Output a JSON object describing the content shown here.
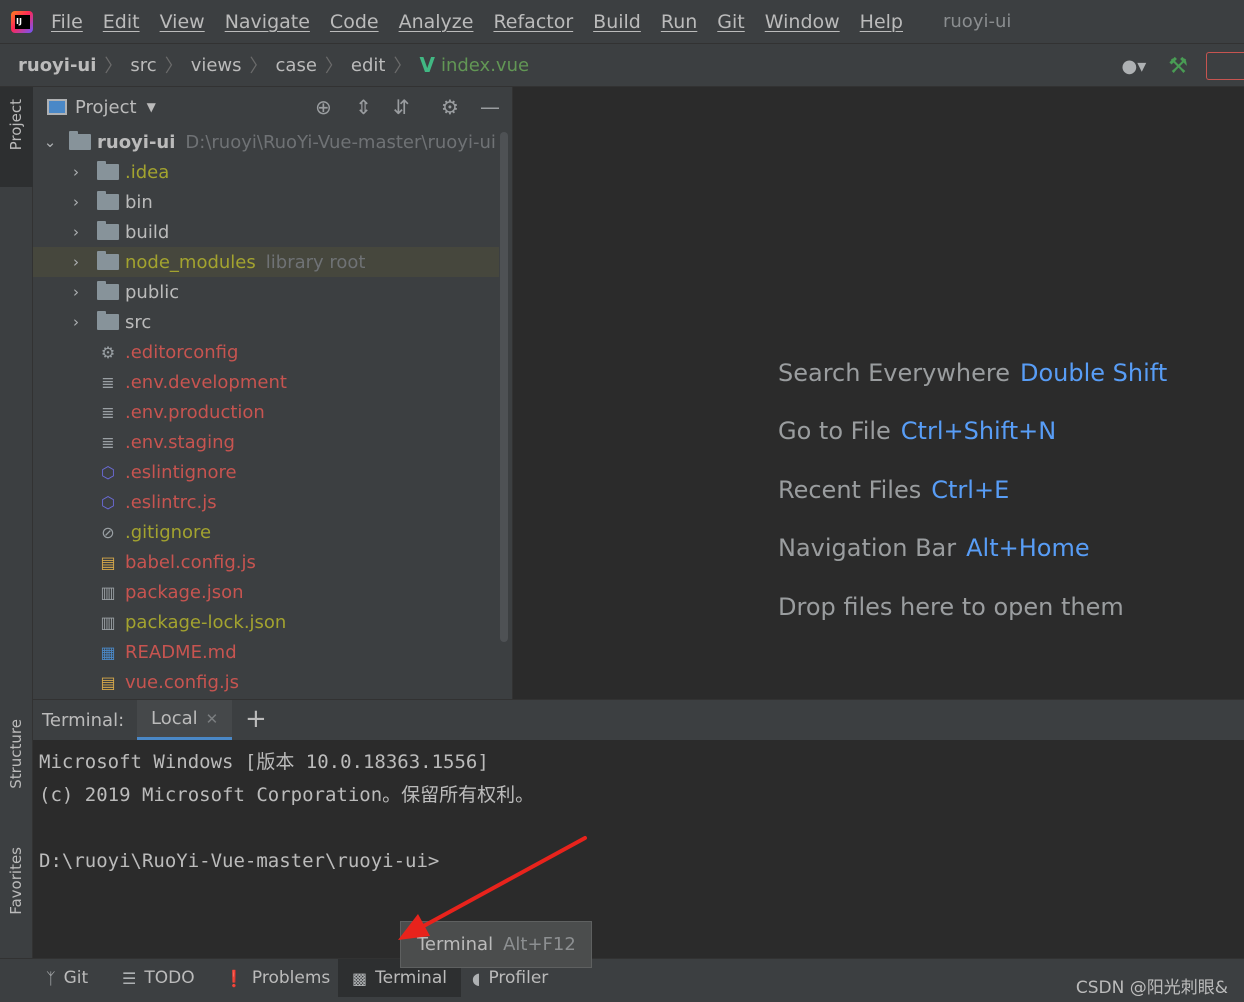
{
  "menubar": {
    "items": [
      "File",
      "Edit",
      "View",
      "Navigate",
      "Code",
      "Analyze",
      "Refactor",
      "Build",
      "Run",
      "Git",
      "Window",
      "Help"
    ],
    "window_title": "ruoyi-ui"
  },
  "navbar": {
    "crumbs": [
      "ruoyi-ui",
      "src",
      "views",
      "case",
      "edit"
    ],
    "file": "index.vue"
  },
  "left_strip": {
    "project": "Project",
    "structure": "Structure",
    "favorites": "Favorites"
  },
  "project": {
    "title": "Project",
    "root_name": "ruoyi-ui",
    "root_path": "D:\\ruoyi\\RuoYi-Vue-master\\ruoyi-ui",
    "folders": [
      {
        "name": ".idea",
        "color": "olive"
      },
      {
        "name": "bin",
        "color": "normal"
      },
      {
        "name": "build",
        "color": "normal"
      },
      {
        "name": "node_modules",
        "color": "olive",
        "hint": "library root"
      },
      {
        "name": "public",
        "color": "normal"
      },
      {
        "name": "src",
        "color": "normal"
      }
    ],
    "files": [
      {
        "name": ".editorconfig",
        "color": "red",
        "icon": "gear-icon"
      },
      {
        "name": ".env.development",
        "color": "red",
        "icon": "text-file-icon"
      },
      {
        "name": ".env.production",
        "color": "red",
        "icon": "text-file-icon"
      },
      {
        "name": ".env.staging",
        "color": "red",
        "icon": "text-file-icon"
      },
      {
        "name": ".eslintignore",
        "color": "red",
        "icon": "eslint-icon"
      },
      {
        "name": ".eslintrc.js",
        "color": "red",
        "icon": "eslint-icon"
      },
      {
        "name": ".gitignore",
        "color": "olive",
        "icon": "ignore-file-icon"
      },
      {
        "name": "babel.config.js",
        "color": "red",
        "icon": "js-file-icon"
      },
      {
        "name": "package.json",
        "color": "red",
        "icon": "json-file-icon"
      },
      {
        "name": "package-lock.json",
        "color": "olive",
        "icon": "json-file-icon"
      },
      {
        "name": "README.md",
        "color": "red",
        "icon": "markdown-file-icon"
      },
      {
        "name": "vue.config.js",
        "color": "red",
        "icon": "js-file-icon"
      }
    ]
  },
  "editor_hints": [
    {
      "label": "Search Everywhere",
      "key": "Double Shift"
    },
    {
      "label": "Go to File",
      "key": "Ctrl+Shift+N"
    },
    {
      "label": "Recent Files",
      "key": "Ctrl+E"
    },
    {
      "label": "Navigation Bar",
      "key": "Alt+Home"
    },
    {
      "label": "Drop files here to open them",
      "key": ""
    }
  ],
  "terminal": {
    "label": "Terminal:",
    "tab": "Local",
    "lines": [
      "Microsoft Windows [版本 10.0.18363.1556]",
      "(c) 2019 Microsoft Corporation。保留所有权利。",
      "",
      "D:\\ruoyi\\RuoYi-Vue-master\\ruoyi-ui>"
    ]
  },
  "tooltip": {
    "label": "Terminal",
    "key": "Alt+F12"
  },
  "bottombar": {
    "tabs": [
      "Git",
      "TODO",
      "Problems",
      "Terminal",
      "Profiler"
    ],
    "watermark": "CSDN @阳光刺眼&"
  },
  "colors": {
    "olive": "#a3a32f",
    "red": "#c75450",
    "normal": "#bbbbbb",
    "accent": "#589df6",
    "arrow": "#e8231c"
  }
}
